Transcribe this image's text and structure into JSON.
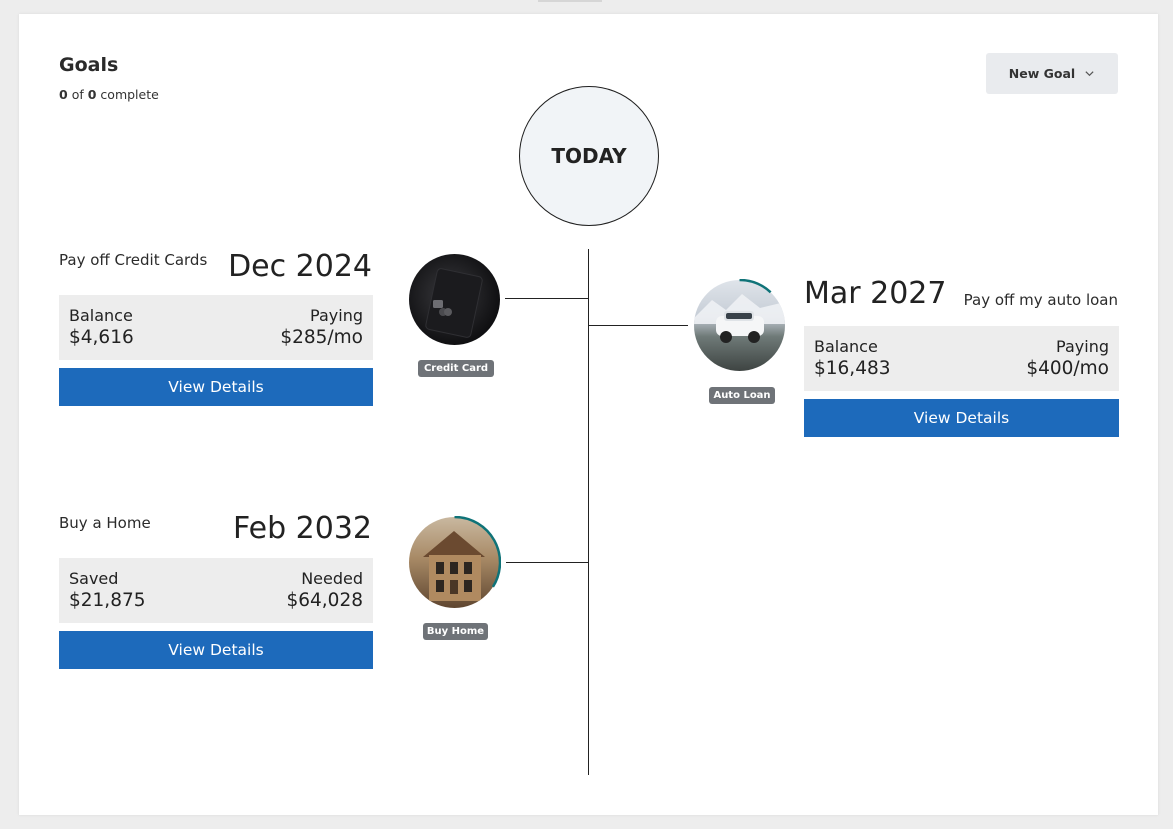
{
  "header": {
    "title": "Goals",
    "complete_count": "0",
    "of_word": "of",
    "total_count": "0",
    "complete_word": "complete",
    "new_goal_label": "New Goal"
  },
  "timeline": {
    "today_label": "TODAY"
  },
  "goals": [
    {
      "name": "Pay off Credit Cards",
      "date": "Dec 2024",
      "left_label": "Balance",
      "left_value": "$4,616",
      "right_label": "Paying",
      "right_value": "$285/mo",
      "button_label": "View Details",
      "badge": "Credit Card",
      "progress": 0
    },
    {
      "name": "Pay off my auto loan",
      "date": "Mar 2027",
      "left_label": "Balance",
      "left_value": "$16,483",
      "right_label": "Paying",
      "right_value": "$400/mo",
      "button_label": "View Details",
      "badge": "Auto Loan",
      "progress": 0.12
    },
    {
      "name": "Buy a Home",
      "date": "Feb 2032",
      "left_label": "Saved",
      "left_value": "$21,875",
      "right_label": "Needed",
      "right_value": "$64,028",
      "button_label": "View Details",
      "badge": "Buy Home",
      "progress": 0.34
    }
  ],
  "colors": {
    "button_blue": "#1d6abb",
    "progress_teal": "#0f7378",
    "stat_bg": "#ededed",
    "today_bg": "#f1f4f7"
  }
}
